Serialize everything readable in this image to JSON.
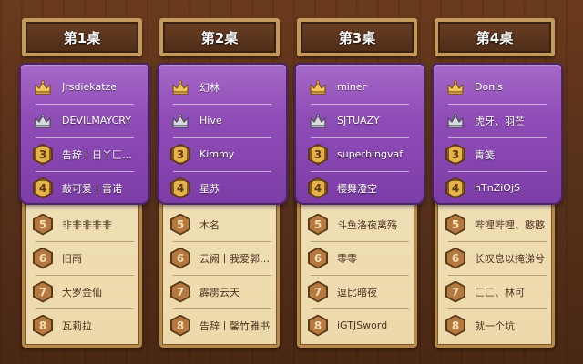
{
  "tables": [
    {
      "title": "第1桌",
      "players": [
        {
          "rank": "1",
          "name": "Jrsdiekatze"
        },
        {
          "rank": "2",
          "name": "DEVILMAYCRY"
        },
        {
          "rank": "3",
          "name": "告辞丨日丫匚…"
        },
        {
          "rank": "4",
          "name": "敲可爱丨雷诺"
        },
        {
          "rank": "5",
          "name": "非非非非非"
        },
        {
          "rank": "6",
          "name": "旧雨"
        },
        {
          "rank": "7",
          "name": "大罗金仙"
        },
        {
          "rank": "8",
          "name": "瓦莉拉"
        }
      ]
    },
    {
      "title": "第2桌",
      "players": [
        {
          "rank": "1",
          "name": "幻林"
        },
        {
          "rank": "2",
          "name": "Hive"
        },
        {
          "rank": "3",
          "name": "Kimmy"
        },
        {
          "rank": "4",
          "name": "星苏"
        },
        {
          "rank": "5",
          "name": "木名"
        },
        {
          "rank": "6",
          "name": "云阙丨我爱郭…"
        },
        {
          "rank": "7",
          "name": "霹雳云天"
        },
        {
          "rank": "8",
          "name": "告辞丨馨竹雅书"
        }
      ]
    },
    {
      "title": "第3桌",
      "players": [
        {
          "rank": "1",
          "name": "miner"
        },
        {
          "rank": "2",
          "name": "SJTUAZY"
        },
        {
          "rank": "3",
          "name": "superbingvaf"
        },
        {
          "rank": "4",
          "name": "樱舞澄空"
        },
        {
          "rank": "5",
          "name": "斗鱼洛夜离殇"
        },
        {
          "rank": "6",
          "name": "零零"
        },
        {
          "rank": "7",
          "name": "逗比暗夜"
        },
        {
          "rank": "8",
          "name": "iGTJSword"
        }
      ]
    },
    {
      "title": "第4桌",
      "players": [
        {
          "rank": "1",
          "name": "Donis"
        },
        {
          "rank": "2",
          "name": "虎牙、羽芒"
        },
        {
          "rank": "3",
          "name": "青笺"
        },
        {
          "rank": "4",
          "name": "hTnZiOjS"
        },
        {
          "rank": "5",
          "name": "哔哩哔哩、憨憨"
        },
        {
          "rank": "6",
          "name": "长叹息以掩涕兮"
        },
        {
          "rank": "7",
          "name": "匚匚、林可"
        },
        {
          "rank": "8",
          "name": "就一个坑"
        }
      ]
    }
  ],
  "icons": {
    "rank1": "gold-crown-icon",
    "rank2": "silver-crown-icon",
    "rank3_8": "hexagon-rank-badge-icon"
  },
  "colors": {
    "gold": "#e8b24a",
    "silver": "#c9cbd2",
    "purple": "#8e4cb6",
    "parchment": "#efdcb0"
  }
}
